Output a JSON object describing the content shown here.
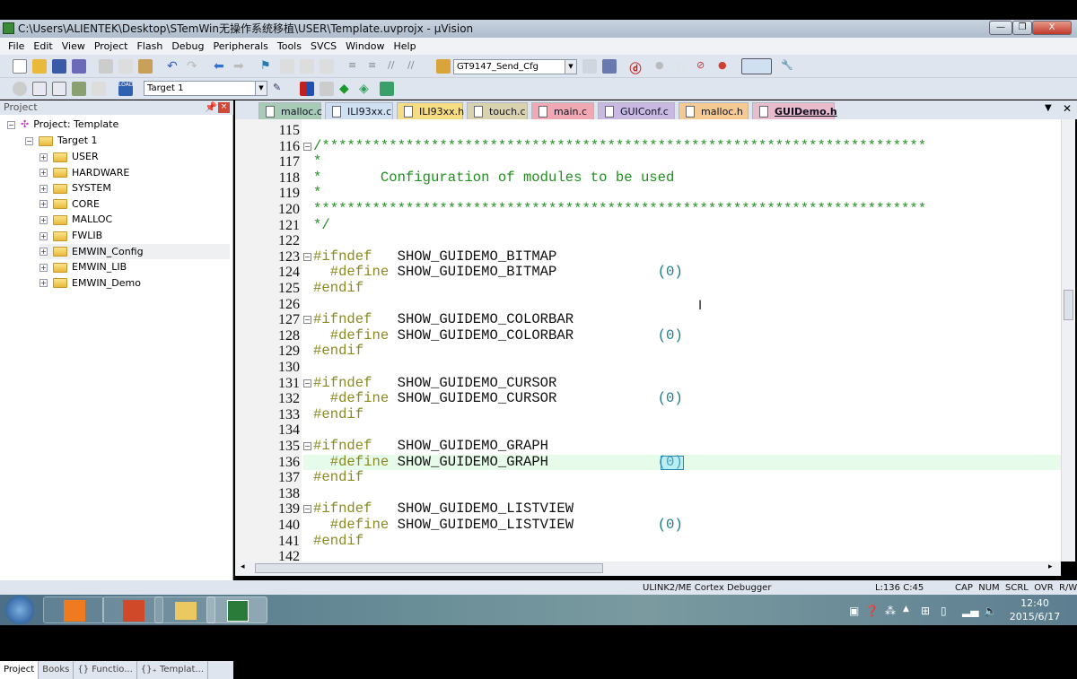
{
  "window": {
    "title": "C:\\Users\\ALIENTEK\\Desktop\\STemWin无操作系统移植\\USER\\Template.uvprojx - µVision",
    "minimize": "—",
    "maximize": "❐",
    "close": "X"
  },
  "menu": [
    "File",
    "Edit",
    "View",
    "Project",
    "Flash",
    "Debug",
    "Peripherals",
    "Tools",
    "SVCS",
    "Window",
    "Help"
  ],
  "toolbar": {
    "find_value": "GT9147_Send_Cfg",
    "target_value": "Target 1"
  },
  "project_panel": {
    "title": "Project",
    "root": "Project: Template",
    "target": "Target 1",
    "groups": [
      "USER",
      "HARDWARE",
      "SYSTEM",
      "CORE",
      "MALLOC",
      "FWLIB",
      "EMWIN_Config",
      "EMWIN_LIB",
      "EMWIN_Demo"
    ],
    "selected": "EMWIN_Config",
    "tabs": [
      "Project",
      "Books",
      "{} Functio...",
      "{}₊ Templat..."
    ]
  },
  "file_tabs": [
    {
      "label": "malloc.c",
      "color": "#a8cbb5"
    },
    {
      "label": "ILI93xx.c",
      "color": "#cfe0f2"
    },
    {
      "label": "ILI93xx.h",
      "color": "#f6dc82"
    },
    {
      "label": "touch.c",
      "color": "#d8d2ae"
    },
    {
      "label": "main.c",
      "color": "#f0a9b2"
    },
    {
      "label": "GUIConf.c",
      "color": "#c9b9e2"
    },
    {
      "label": "malloc.h",
      "color": "#f4c992"
    },
    {
      "label": "GUIDemo.h",
      "color": "#e8bccb",
      "active": true
    }
  ],
  "editor": {
    "first_line": 115,
    "current_line": 136,
    "current_line_color": "#e6fbe9",
    "lines": [
      "",
      "/************************************************************************",
      "*",
      "*       Configuration of modules to be used",
      "*",
      "*************************************************************************",
      "*/",
      "",
      "#ifndef   SHOW_GUIDEMO_BITMAP",
      "  #define SHOW_GUIDEMO_BITMAP            (0)",
      "#endif",
      "",
      "#ifndef   SHOW_GUIDEMO_COLORBAR",
      "  #define SHOW_GUIDEMO_COLORBAR          (0)",
      "#endif",
      "",
      "#ifndef   SHOW_GUIDEMO_CURSOR",
      "  #define SHOW_GUIDEMO_CURSOR            (0)",
      "#endif",
      "",
      "#ifndef   SHOW_GUIDEMO_GRAPH",
      "  #define SHOW_GUIDEMO_GRAPH             (0)",
      "#endif",
      "",
      "#ifndef   SHOW_GUIDEMO_LISTVIEW",
      "  #define SHOW_GUIDEMO_LISTVIEW          (0)",
      "#endif",
      ""
    ]
  },
  "status": {
    "debugger": "ULINK2/ME Cortex Debugger",
    "position": "L:136 C:45",
    "indicators": "CAP  NUM  SCRL  OVR  R/W"
  },
  "taskbar": {
    "time": "12:40",
    "date": "2015/6/17",
    "apps": [
      "foxit-pdf",
      "powerpoint",
      "file-explorer",
      "keil-uvision"
    ]
  }
}
